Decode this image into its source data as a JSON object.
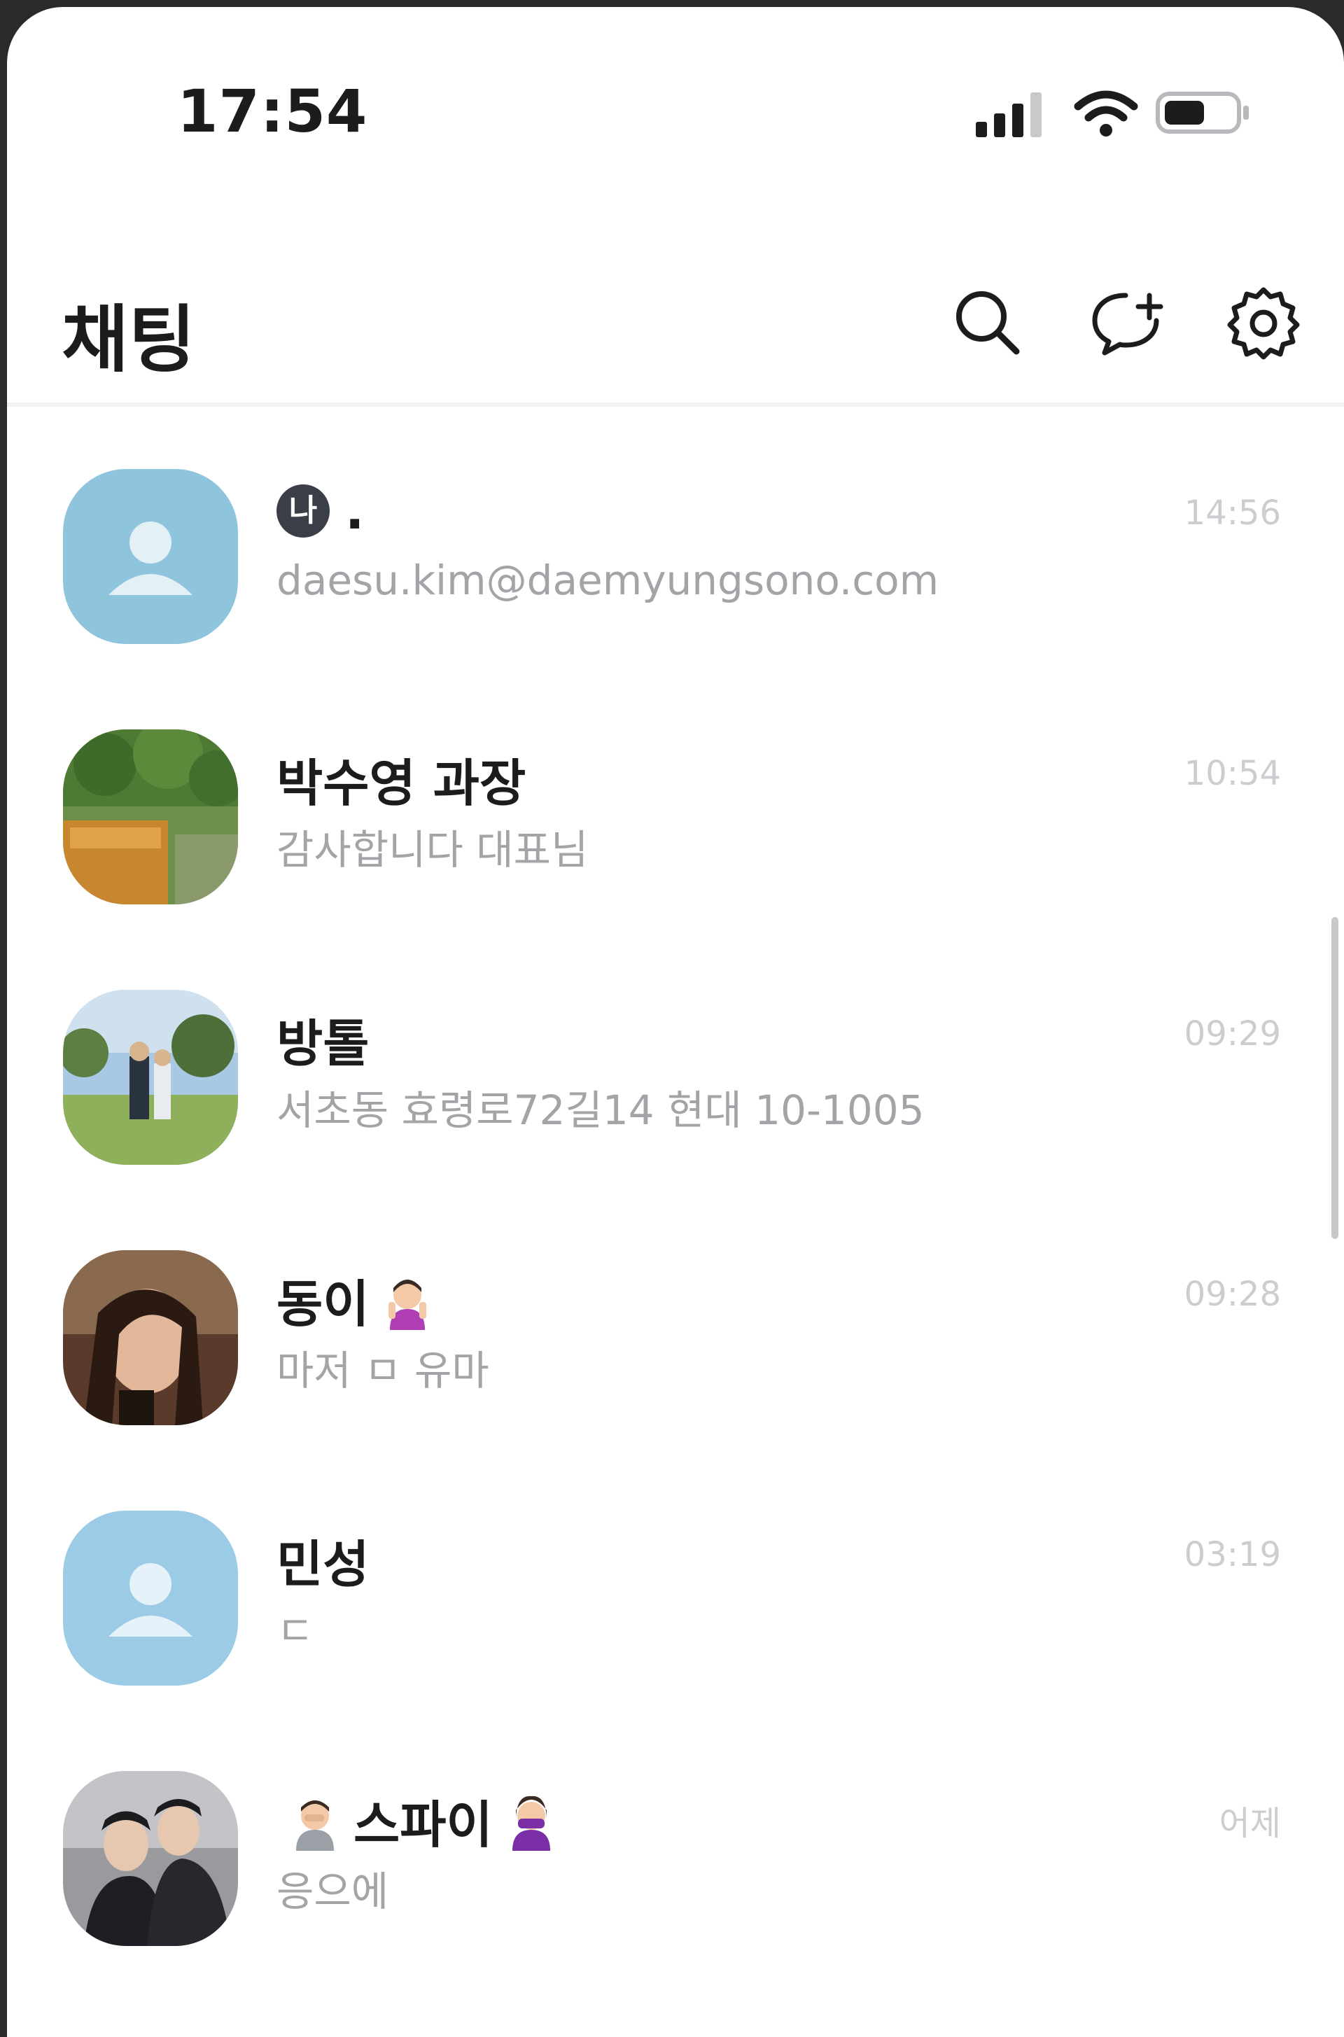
{
  "status_bar": {
    "time": "17:54"
  },
  "header": {
    "title": "채팅"
  },
  "chats": [
    {
      "name": "",
      "me_badge": "나",
      "name_suffix": ".",
      "preview": "daesu.kim@daemyungsono.com",
      "time": "14:56"
    },
    {
      "name": "박수영 과장",
      "preview": "감사합니다 대표님",
      "time": "10:54"
    },
    {
      "name": "방톨",
      "preview": "서초동 효령로72길14 현대 10-1005",
      "time": "09:29"
    },
    {
      "name": "동이",
      "preview": "마저 ㅁ 유마",
      "time": "09:28"
    },
    {
      "name": "민성",
      "preview": "ㄷ",
      "time": "03:19"
    },
    {
      "name": "스파이",
      "preview": "응으에",
      "time": "어제"
    }
  ],
  "colors": {
    "default_avatar_blue": "#8ec5dd",
    "default_avatar_blue_2": "#9ccbe6",
    "badge_dark": "#3a3f47"
  }
}
